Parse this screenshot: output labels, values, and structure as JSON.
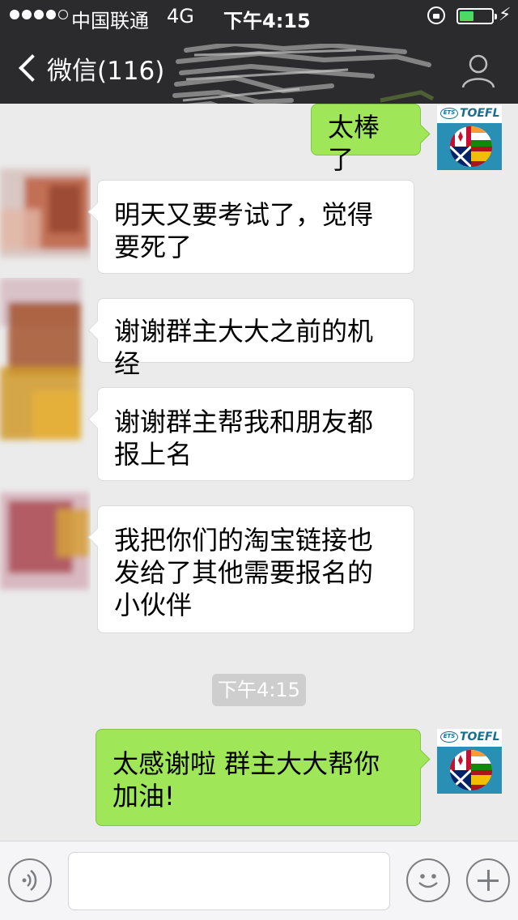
{
  "status_bar": {
    "carrier": "中国联通",
    "network": "4G",
    "time": "下午4:15",
    "signal_bars": 4,
    "signal_total": 5,
    "battery_level": 0.45,
    "icons": [
      "signal-icon",
      "lock-rotation-icon",
      "battery-icon",
      "charging-icon"
    ]
  },
  "nav": {
    "back_label": "微信(116)",
    "back_icon": "chevron-left-icon",
    "profile_icon": "person-icon"
  },
  "messages": [
    {
      "direction": "out",
      "text": "太棒了",
      "avatar": "toefl-avatar"
    },
    {
      "direction": "in",
      "text": "明天又要考试了，觉得要死了",
      "avatar": "blurred-avatar"
    },
    {
      "direction": "in",
      "text": "谢谢群主大大之前的机经",
      "avatar": "blurred-avatar"
    },
    {
      "direction": "in",
      "text": "谢谢群主帮我和朋友都报上名",
      "avatar": "blurred-avatar"
    },
    {
      "direction": "in",
      "text": "我把你们的淘宝链接也发给了其他需要报名的小伙伴",
      "avatar": "blurred-avatar"
    },
    {
      "direction": "out",
      "text": "太感谢啦 群主大大帮你加油!",
      "avatar": "toefl-avatar"
    }
  ],
  "timestamp": "下午4:15",
  "toefl_avatar": {
    "badge": "ETS",
    "brand": "TOEFL",
    "colors": {
      "header": "#ffffff",
      "body": "#2a8fb5",
      "brand_text": "#1b6f8c"
    }
  },
  "toolbar": {
    "voice_icon": "voice-icon",
    "input_value": "",
    "emoji_icon": "emoji-icon",
    "plus_icon": "plus-icon"
  },
  "colors": {
    "nav_background": "#2b2b2d",
    "chat_background": "#ebebeb",
    "outgoing_bubble": "#9fe658",
    "incoming_bubble": "#ffffff",
    "timestamp_pill": "#cecece"
  }
}
